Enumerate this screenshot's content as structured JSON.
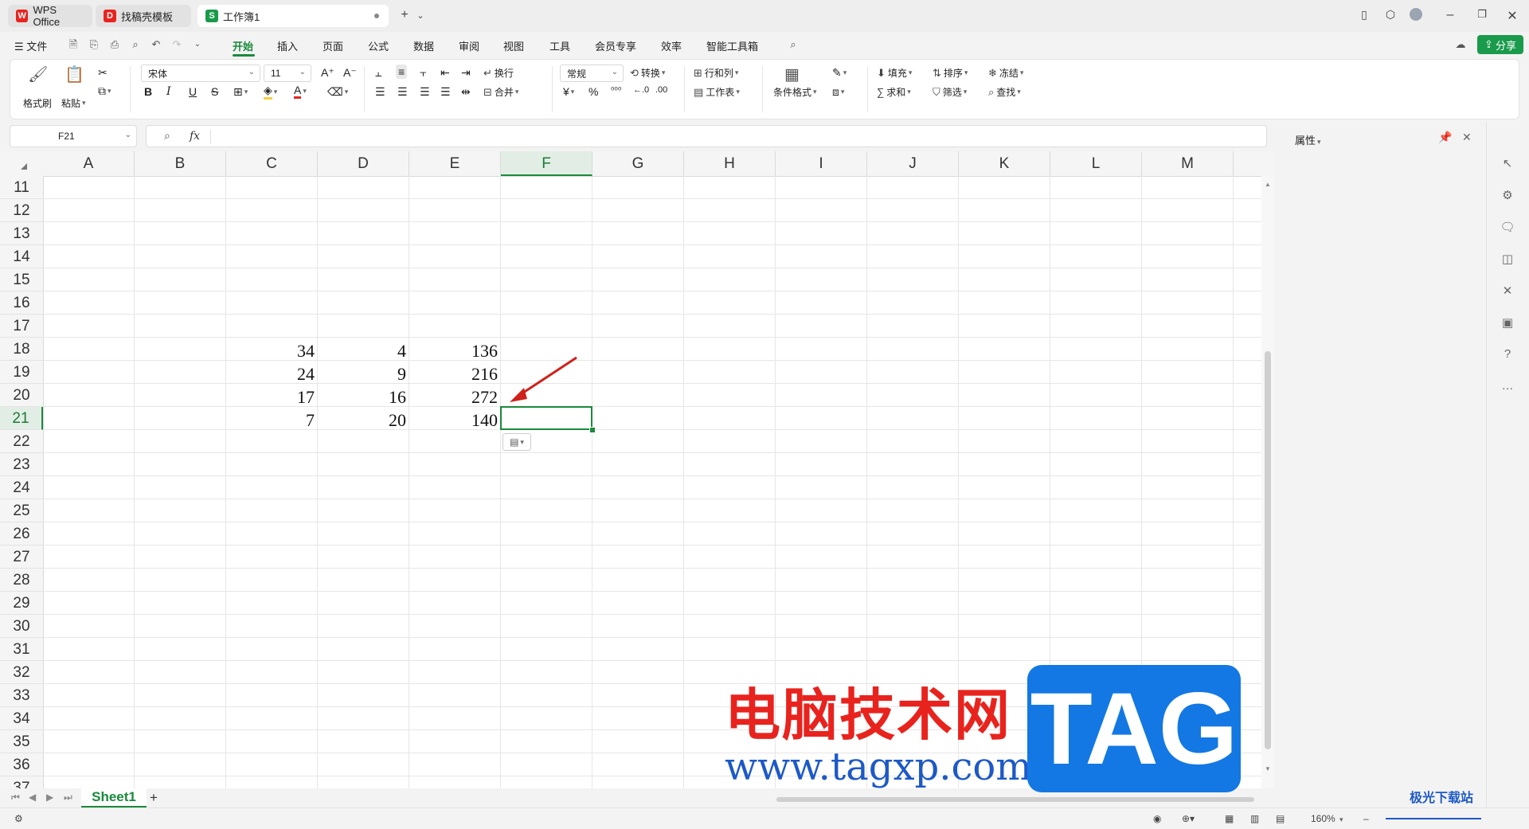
{
  "tabs": [
    {
      "label": "WPS Office",
      "icon": "wps-logo-icon",
      "color": "#e8231e"
    },
    {
      "label": "找稿壳模板",
      "icon": "template-icon",
      "color": "#e8231e"
    },
    {
      "label": "工作簿1",
      "icon": "spreadsheet-icon",
      "color": "#1a9b4b",
      "icon_letter": "S"
    }
  ],
  "menu": {
    "file": "文件",
    "items": [
      "开始",
      "插入",
      "页面",
      "公式",
      "数据",
      "审阅",
      "视图",
      "工具",
      "会员专享",
      "效率",
      "智能工具箱"
    ],
    "active": "开始",
    "share": "分享"
  },
  "ribbon": {
    "format_painter": "格式刷",
    "paste": "粘贴",
    "font_name": "宋体",
    "font_size": "11",
    "bold": "B",
    "italic": "I",
    "underline": "U",
    "strike": "S",
    "wrap": "换行",
    "merge": "合并",
    "number_format": "常规",
    "convert": "转换",
    "row_col": "行和列",
    "worksheet": "工作表",
    "cond_format": "条件格式",
    "fill": "填充",
    "sort": "排序",
    "freeze": "冻结",
    "sum": "求和",
    "filter": "筛选",
    "find": "查找",
    "currency": "¥",
    "percent": "%"
  },
  "formula_bar": {
    "name_box": "F21",
    "fx": "fx",
    "content": ""
  },
  "columns": [
    "A",
    "B",
    "C",
    "D",
    "E",
    "F",
    "G",
    "H",
    "I",
    "J",
    "K",
    "L",
    "M"
  ],
  "selected_column": "F",
  "rows": [
    "11",
    "12",
    "13",
    "14",
    "15",
    "16",
    "17",
    "18",
    "19",
    "20",
    "21",
    "22",
    "23",
    "24",
    "25",
    "26",
    "27",
    "28",
    "29",
    "30",
    "31",
    "32",
    "33",
    "34",
    "35",
    "36",
    "37"
  ],
  "selected_row": "21",
  "cells": [
    {
      "ref": "C18",
      "value": "34"
    },
    {
      "ref": "D18",
      "value": "4"
    },
    {
      "ref": "E18",
      "value": "136"
    },
    {
      "ref": "C19",
      "value": "24"
    },
    {
      "ref": "D19",
      "value": "9"
    },
    {
      "ref": "E19",
      "value": "216"
    },
    {
      "ref": "C20",
      "value": "17"
    },
    {
      "ref": "D20",
      "value": "16"
    },
    {
      "ref": "E20",
      "value": "272"
    },
    {
      "ref": "C21",
      "value": "7"
    },
    {
      "ref": "D21",
      "value": "20"
    },
    {
      "ref": "E21",
      "value": "140"
    }
  ],
  "sheet_tab": "Sheet1",
  "add_sheet": "+",
  "properties_panel": {
    "title": "属性"
  },
  "status": {
    "zoom": "160%"
  },
  "watermark": {
    "cn": "电脑技术网",
    "url": "www.tagxp.com",
    "tag": "TAG",
    "corner": "极光下载站"
  },
  "colors": {
    "accent": "#1a8a3b",
    "arrow": "#d0201b"
  }
}
